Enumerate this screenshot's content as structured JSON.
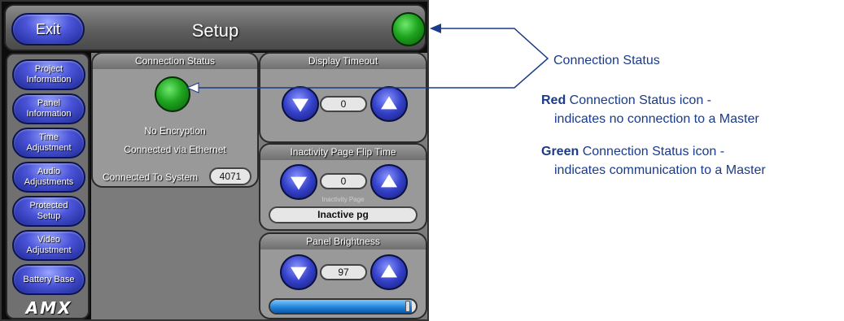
{
  "header": {
    "title": "Setup",
    "exit_label": "Exit",
    "status_led_color": "#1ea51e"
  },
  "sidebar": {
    "items": [
      {
        "label": "Project Information"
      },
      {
        "label": "Panel Information"
      },
      {
        "label": "Time Adjustment"
      },
      {
        "label": "Audio Adjustments"
      },
      {
        "label": "Protected Setup"
      },
      {
        "label": "Video Adjustment"
      },
      {
        "label": "Battery Base"
      }
    ],
    "logo_text": "AMX"
  },
  "connection_status": {
    "title": "Connection Status",
    "led_color": "#1ea51e",
    "encryption": "No Encryption",
    "connection": "Connected via Ethernet",
    "system_label": "Connected To System",
    "system_value": "4071"
  },
  "display_timeout": {
    "title": "Display Timeout",
    "value": "0"
  },
  "inactivity": {
    "title": "Inactivity Page Flip Time",
    "value": "0",
    "page_label": "Inactivity Page",
    "page_value": "Inactive pg"
  },
  "brightness": {
    "title": "Panel Brightness",
    "value": "97",
    "level_fraction": 0.97
  },
  "annotations": {
    "callout_title": "Connection Status",
    "red_bold": "Red",
    "red_line1": " Connection Status icon -",
    "red_line2": "indicates no connection to a Master",
    "green_bold": "Green",
    "green_line1": " Connection Status icon -",
    "green_line2": "indicates communication to a Master"
  }
}
